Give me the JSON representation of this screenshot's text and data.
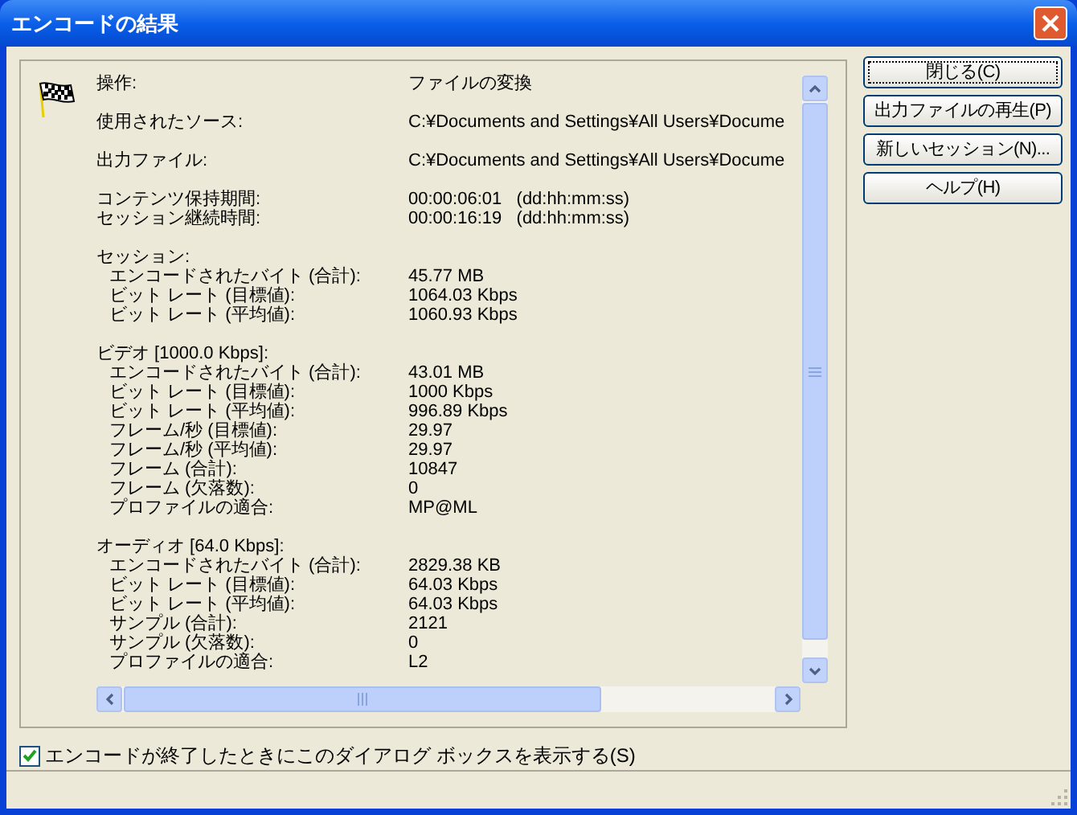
{
  "window": {
    "title": "エンコードの結果"
  },
  "groups": [
    {
      "rows": [
        {
          "label": "操作:",
          "value": "ファイルの変換"
        }
      ]
    },
    {
      "rows": [
        {
          "label": "使用されたソース:",
          "value": "C:¥Documents and Settings¥All Users¥Docume"
        }
      ]
    },
    {
      "rows": [
        {
          "label": "出力ファイル:",
          "value": "C:¥Documents and Settings¥All Users¥Docume"
        }
      ]
    },
    {
      "rows": [
        {
          "label": "コンテンツ保持期間:",
          "value": "00:00:06:01   (dd:hh:mm:ss)"
        },
        {
          "label": "セッション継続時間:",
          "value": "00:00:16:19   (dd:hh:mm:ss)"
        }
      ]
    },
    {
      "heading": "セッション:",
      "rows": [
        {
          "label": "エンコードされたバイト (合計):",
          "value": "45.77 MB"
        },
        {
          "label": "ビット レート (目標値):",
          "value": "1064.03 Kbps"
        },
        {
          "label": "ビット レート (平均値):",
          "value": "1060.93 Kbps"
        }
      ]
    },
    {
      "heading": "ビデオ [1000.0 Kbps]:",
      "rows": [
        {
          "label": "エンコードされたバイト (合計):",
          "value": "43.01 MB"
        },
        {
          "label": "ビット レート (目標値):",
          "value": "1000 Kbps"
        },
        {
          "label": "ビット レート (平均値):",
          "value": "996.89 Kbps"
        },
        {
          "label": "フレーム/秒 (目標値):",
          "value": "29.97"
        },
        {
          "label": "フレーム/秒 (平均値):",
          "value": "29.97"
        },
        {
          "label": "フレーム (合計):",
          "value": "10847"
        },
        {
          "label": "フレーム (欠落数):",
          "value": "0"
        },
        {
          "label": "プロファイルの適合:",
          "value": "MP@ML"
        }
      ]
    },
    {
      "heading": "オーディオ [64.0 Kbps]:",
      "rows": [
        {
          "label": "エンコードされたバイト (合計):",
          "value": "2829.38 KB"
        },
        {
          "label": "ビット レート (目標値):",
          "value": "64.03 Kbps"
        },
        {
          "label": "ビット レート (平均値):",
          "value": "64.03 Kbps"
        },
        {
          "label": "サンプル (合計):",
          "value": "2121"
        },
        {
          "label": "サンプル (欠落数):",
          "value": "0"
        },
        {
          "label": "プロファイルの適合:",
          "value": "L2"
        }
      ]
    }
  ],
  "buttons": [
    {
      "label": "閉じる(C)",
      "focused": true
    },
    {
      "label": "出力ファイルの再生(P)",
      "focused": false
    },
    {
      "label": "新しいセッション(N)...",
      "focused": false
    },
    {
      "label": "ヘルプ(H)",
      "focused": false
    }
  ],
  "show_dialog_checkbox": {
    "label": "エンコードが終了したときにこのダイアログ ボックスを表示する(S)",
    "checked": true
  }
}
